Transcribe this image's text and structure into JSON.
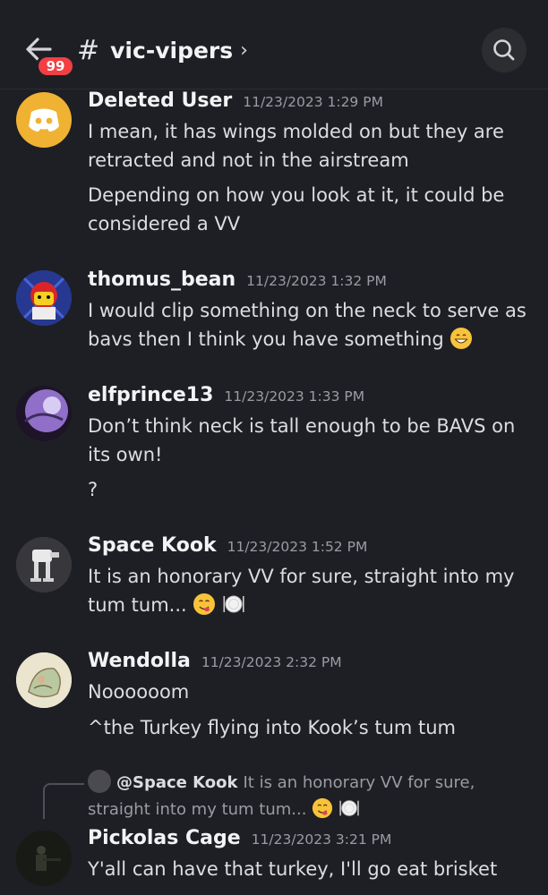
{
  "header": {
    "unread_badge": "99",
    "hash": "#",
    "channel_name": "vic-vipers",
    "chevron": "›",
    "back_icon": "arrow-left-icon",
    "search_icon": "search-icon"
  },
  "messages": [
    {
      "author": "Deleted User",
      "timestamp": "11/23/2023 1:29 PM",
      "lines": [
        "I mean, it has wings molded on but they are retracted and not in the airstream",
        "Depending on how you look at it, it could be considered a VV"
      ]
    },
    {
      "author": "thomus_bean",
      "timestamp": "11/23/2023 1:32 PM",
      "lines": [
        "I would clip something on the neck to serve as bavs then I think you have something"
      ]
    },
    {
      "author": "elfprince13",
      "timestamp": "11/23/2023 1:33 PM",
      "lines": [
        "Don’t think neck is tall enough to be BAVS on its own!",
        "?"
      ]
    },
    {
      "author": "Space Kook",
      "timestamp": "11/23/2023 1:52 PM",
      "lines": [
        "It is an honorary VV for sure, straight into my tum tum..."
      ]
    },
    {
      "author": "Wendolla",
      "timestamp": "11/23/2023 2:32 PM",
      "lines": [
        "Noooooom",
        "^the Turkey flying into Kook’s tum tum"
      ]
    },
    {
      "author": "Pickolas Cage",
      "timestamp": "11/23/2023 3:21 PM",
      "lines": [
        "Y'all can have that turkey, I'll go eat brisket"
      ],
      "reply": {
        "author": "@Space Kook",
        "text": "It is an honorary VV for sure, straight into my tum tum..."
      }
    }
  ]
}
